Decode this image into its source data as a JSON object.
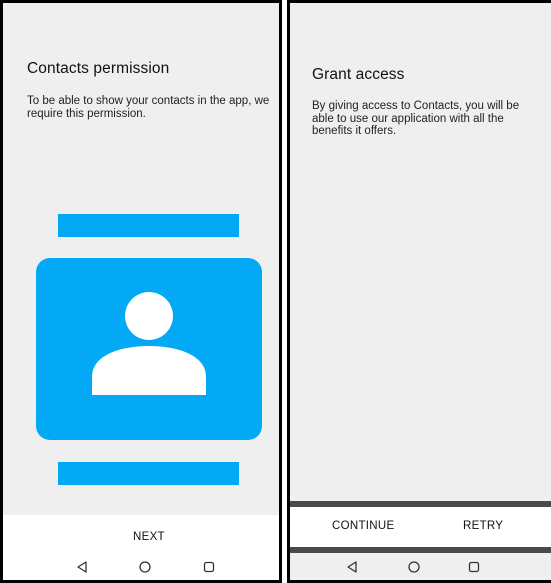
{
  "left": {
    "title": "Contacts permission",
    "body": "To be able to show your contacts in the app, we require this permission.",
    "next_label": "NEXT",
    "illustration_icon": "contact-card-icon",
    "accent_color": "#03a9f4"
  },
  "right": {
    "title": "Grant access",
    "body": "By giving access to Contacts, you will be able to use our application with all the benefits it offers.",
    "continue_label": "CONTINUE",
    "retry_label": "RETRY"
  },
  "navbar": {
    "icons": [
      "back-icon",
      "home-icon",
      "recents-icon"
    ]
  }
}
